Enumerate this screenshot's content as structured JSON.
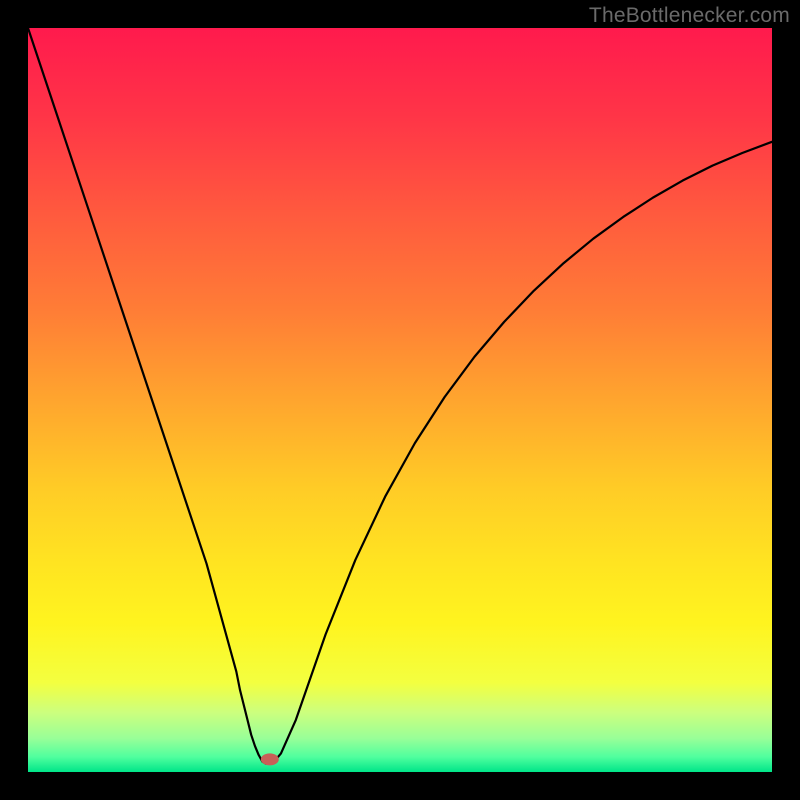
{
  "watermark": "TheBottlenecker.com",
  "chart_data": {
    "type": "line",
    "title": "",
    "xlabel": "",
    "ylabel": "",
    "xlim": [
      0,
      1
    ],
    "ylim": [
      0,
      1
    ],
    "notch_x": 0.312,
    "marker": {
      "x": 0.325,
      "y": 0.017,
      "color": "#c86058",
      "rx": 9,
      "ry": 6
    },
    "series": [
      {
        "name": "curve",
        "color": "#000000",
        "x": [
          0.0,
          0.04,
          0.08,
          0.12,
          0.16,
          0.2,
          0.24,
          0.28,
          0.285,
          0.29,
          0.295,
          0.3,
          0.305,
          0.31,
          0.315,
          0.32,
          0.33,
          0.34,
          0.36,
          0.4,
          0.44,
          0.48,
          0.52,
          0.56,
          0.6,
          0.64,
          0.68,
          0.72,
          0.76,
          0.8,
          0.84,
          0.88,
          0.92,
          0.96,
          1.0
        ],
        "y": [
          1.0,
          0.88,
          0.76,
          0.64,
          0.52,
          0.4,
          0.28,
          0.135,
          0.11,
          0.09,
          0.07,
          0.05,
          0.035,
          0.023,
          0.014,
          0.011,
          0.013,
          0.025,
          0.07,
          0.185,
          0.285,
          0.37,
          0.442,
          0.504,
          0.558,
          0.605,
          0.647,
          0.684,
          0.717,
          0.746,
          0.772,
          0.795,
          0.815,
          0.832,
          0.847
        ]
      }
    ],
    "gradient_stops": [
      {
        "offset": 0.0,
        "color": "#ff1a4d"
      },
      {
        "offset": 0.12,
        "color": "#ff3547"
      },
      {
        "offset": 0.25,
        "color": "#ff5a3e"
      },
      {
        "offset": 0.38,
        "color": "#ff7d36"
      },
      {
        "offset": 0.5,
        "color": "#ffa52e"
      },
      {
        "offset": 0.62,
        "color": "#ffcc26"
      },
      {
        "offset": 0.72,
        "color": "#ffe421"
      },
      {
        "offset": 0.8,
        "color": "#fff41f"
      },
      {
        "offset": 0.88,
        "color": "#f3ff40"
      },
      {
        "offset": 0.92,
        "color": "#ccff7e"
      },
      {
        "offset": 0.955,
        "color": "#98ff98"
      },
      {
        "offset": 0.98,
        "color": "#4fff9e"
      },
      {
        "offset": 1.0,
        "color": "#00e589"
      }
    ]
  }
}
